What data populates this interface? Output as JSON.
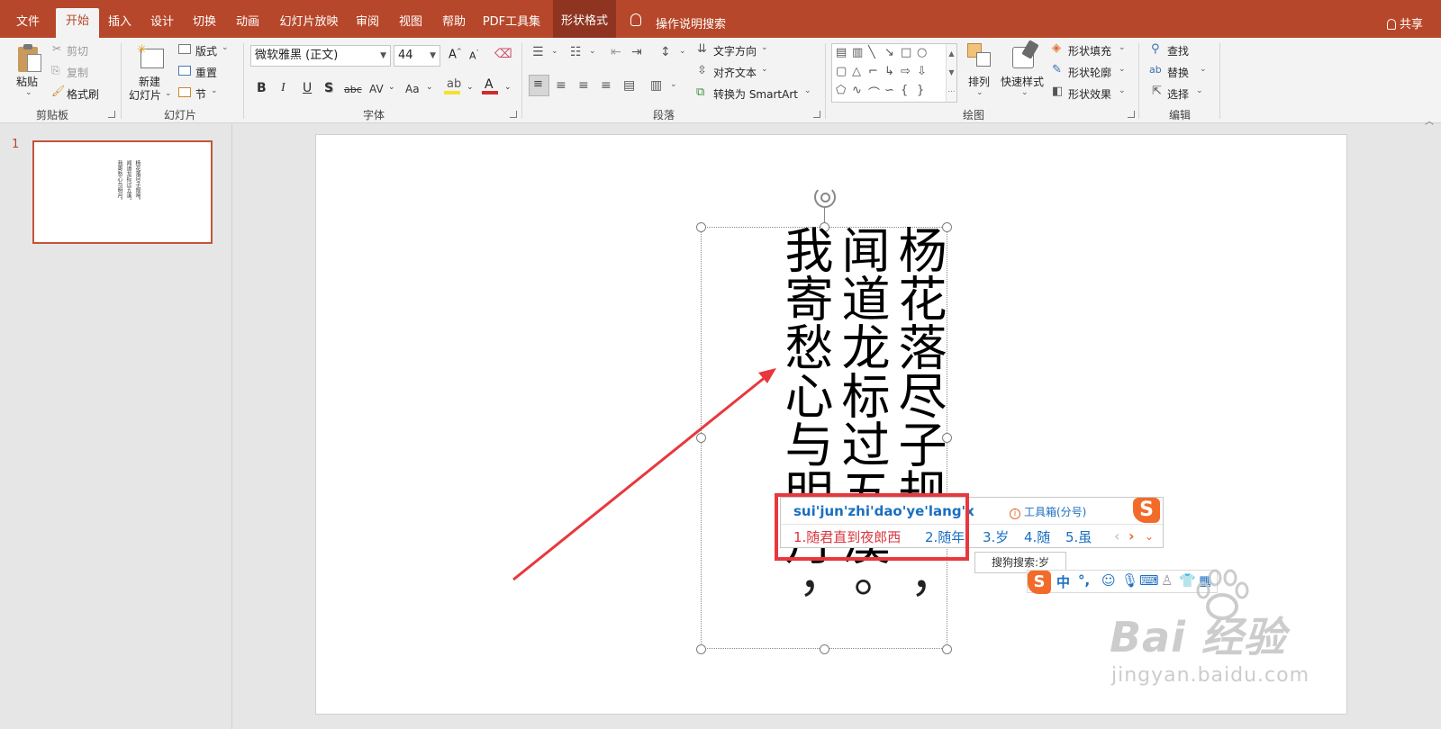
{
  "tabs": {
    "file": "文件",
    "home": "开始",
    "insert": "插入",
    "design": "设计",
    "transitions": "切换",
    "animations": "动画",
    "slideshow": "幻灯片放映",
    "review": "审阅",
    "view": "视图",
    "help": "帮助",
    "pdf": "PDF工具集",
    "shape_format": "形状格式",
    "tell_me": "操作说明搜索",
    "share": "共享"
  },
  "ribbon": {
    "clipboard": {
      "paste": "粘贴",
      "cut": "剪切",
      "copy": "复制",
      "format_painter": "格式刷",
      "group": "剪贴板"
    },
    "slides": {
      "new_slide_1": "新建",
      "new_slide_2": "幻灯片",
      "layout": "版式",
      "reset": "重置",
      "section": "节",
      "group": "幻灯片"
    },
    "font": {
      "font_name": "微软雅黑 (正文)",
      "font_size": "44",
      "bold": "B",
      "italic": "I",
      "underline": "U",
      "shadow": "S",
      "strike": "abc",
      "spacing": "AV",
      "change_case": "Aa",
      "font_color": "A",
      "grow": "A",
      "shrink": "A",
      "group": "字体"
    },
    "paragraph": {
      "text_direction": "文字方向",
      "align_text": "对齐文本",
      "convert_smartart": "转换为 SmartArt",
      "group": "段落"
    },
    "drawing": {
      "arrange": "排列",
      "quick_styles": "快速样式",
      "shape_fill": "形状填充",
      "shape_outline": "形状轮廓",
      "shape_effects": "形状效果",
      "group": "绘图"
    },
    "editing": {
      "find": "查找",
      "replace": "替换",
      "select": "选择",
      "group": "编辑"
    }
  },
  "thumbnail": {
    "number": "1",
    "col1": "杨花落尽子规啼，",
    "col2": "闻道龙标过五溪。",
    "col3": "我寄愁心与明月，"
  },
  "slide": {
    "col1": "杨花落尽子规",
    "col1_tail": "，",
    "col2": "闻道龙标过五溪",
    "col2_tail": "。",
    "col3": "我寄愁心与明月",
    "col3_tail": "，"
  },
  "ime": {
    "pinyin": "sui'jun'zhi'dao'ye'lang'x",
    "toolbox": "工具箱(分号)",
    "cand1": "1.随君直到夜郎西",
    "cand2": "2.随年",
    "cand3": "3.岁",
    "cand4": "4.随",
    "cand5": "5.虽",
    "search": "搜狗搜索:岁",
    "status_lang": "中",
    "status_punct": "°,",
    "logo": "S"
  },
  "watermark": {
    "brand": "Bai  经验",
    "url": "jingyan.baidu.com"
  },
  "colors": {
    "accent": "#b7472a",
    "highlight_box": "#e8383d",
    "ime_blue": "#1a6fc0",
    "ime_red": "#d9363e"
  }
}
